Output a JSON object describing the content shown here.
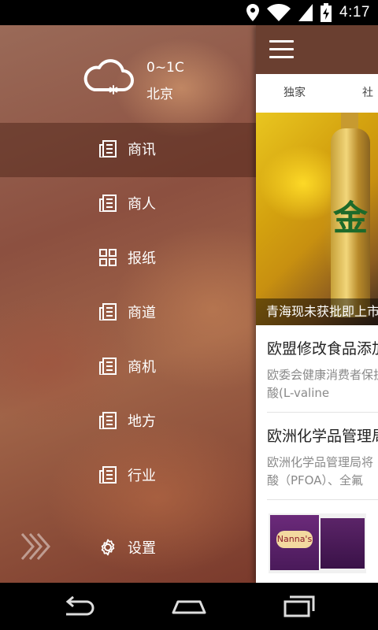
{
  "status_bar": {
    "time": "4:17",
    "icons": [
      "location-icon",
      "wifi-icon",
      "battery-charging-icon"
    ]
  },
  "drawer": {
    "weather": {
      "icon": "cloud-snow-icon",
      "temperature": "0~1C",
      "city": "北京"
    },
    "menu": [
      {
        "label": "商讯",
        "icon": "news-icon",
        "active": true
      },
      {
        "label": "商人",
        "icon": "news-icon",
        "active": false
      },
      {
        "label": "报纸",
        "icon": "grid-icon",
        "active": false
      },
      {
        "label": "商道",
        "icon": "news-icon",
        "active": false
      },
      {
        "label": "商机",
        "icon": "news-icon",
        "active": false
      },
      {
        "label": "地方",
        "icon": "news-icon",
        "active": false
      },
      {
        "label": "行业",
        "icon": "news-icon",
        "active": false
      }
    ],
    "settings_label": "设置"
  },
  "content": {
    "tabs": [
      "独家",
      "社会"
    ],
    "banner_caption": "青海现未获批即上市",
    "banner_bottle_text": "金",
    "articles": [
      {
        "title": "欧盟修改食品添加剂",
        "summary_lines": [
          "欧委会健康消费者保护",
          "酸(L-valine"
        ]
      },
      {
        "title": "欧洲化学品管理局",
        "summary_lines": [
          "欧洲化学品管理局将",
          "酸（PFOA）、全氟"
        ]
      }
    ],
    "thumb_brand": "Nanna's"
  },
  "colors": {
    "toolbar": "#6a3f30",
    "drawer_active": "#4a241a",
    "status_bar": "#000000"
  }
}
